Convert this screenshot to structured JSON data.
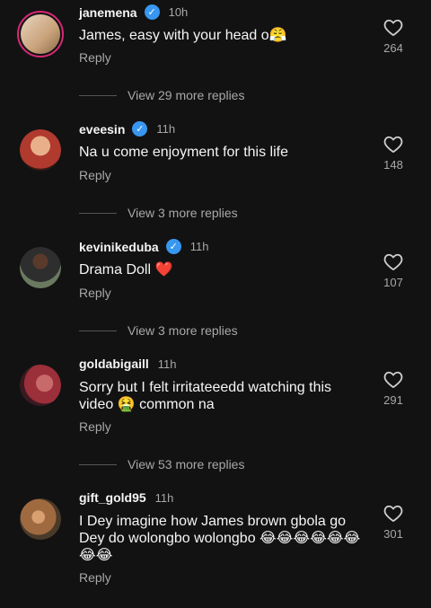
{
  "comments": [
    {
      "username": "janemena",
      "verified": true,
      "time": "10h",
      "text": "James, easy with your head o😤",
      "reply_label": "Reply",
      "likes": "264",
      "more_replies": "View 29 more replies",
      "avatar_color": "#c9a27a",
      "story_ring": true
    },
    {
      "username": "eveesin",
      "verified": true,
      "time": "11h",
      "text": "Na u come enjoyment for this life",
      "reply_label": "Reply",
      "likes": "148",
      "more_replies": "View 3 more replies",
      "avatar_color": "#b03a2e",
      "story_ring": false
    },
    {
      "username": "kevinikeduba",
      "verified": true,
      "time": "11h",
      "text": "Drama Doll ❤️",
      "reply_label": "Reply",
      "likes": "107",
      "more_replies": "View 3 more replies",
      "avatar_color": "#4a5a45",
      "story_ring": false
    },
    {
      "username": "goldabigaill",
      "verified": false,
      "time": "11h",
      "text": "Sorry but I felt irritateeedd watching this video 🤮 common na",
      "reply_label": "Reply",
      "likes": "291",
      "more_replies": "View 53 more replies",
      "avatar_color": "#9b2f3a",
      "story_ring": false
    },
    {
      "username": "gift_gold95",
      "verified": false,
      "time": "11h",
      "text": "I Dey imagine how James brown gbola go Dey do wolongbo wolongbo 😂😂😂😂😂😂😂😂",
      "reply_label": "Reply",
      "likes": "301",
      "avatar_color": "#7a5a3a",
      "story_ring": false
    }
  ]
}
